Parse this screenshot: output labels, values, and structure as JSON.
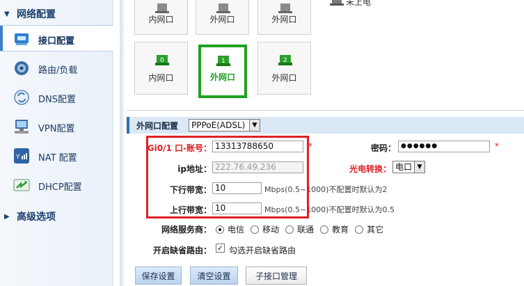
{
  "sidebar": {
    "group_network": "网络配置",
    "items": [
      {
        "label": "接口配置",
        "icon": "network-port-icon"
      },
      {
        "label": "路由/负载",
        "icon": "router-icon"
      },
      {
        "label": "DNS配置",
        "icon": "dns-icon"
      },
      {
        "label": "VPN配置",
        "icon": "vpn-computer-icon"
      },
      {
        "label": "NAT 配置",
        "icon": "nat-icon"
      },
      {
        "label": "DHCP配置",
        "icon": "dhcp-icon"
      }
    ],
    "group_advanced": "高级选项"
  },
  "ports_top": [
    {
      "label": "内网口"
    },
    {
      "label": "外网口"
    },
    {
      "label": "外网口"
    }
  ],
  "legend_unpowered": "未上电",
  "ports_bottom": [
    {
      "num": "0",
      "label": "内网口"
    },
    {
      "num": "1",
      "label": "外网口"
    },
    {
      "num": "2",
      "label": "外网口"
    }
  ],
  "config": {
    "section_title": "外网口配置",
    "mode_value": "PPPoE(ADSL)",
    "account_label": "Gi0/1 口-账号：",
    "account_value": "13313788650",
    "password_label": "密码：",
    "password_value": "●●●●●●",
    "ip_label": "ip地址：",
    "ip_value": "222.76.49.236",
    "optical_label": "光电转换：",
    "optical_value": "电口",
    "down_label": "下行带宽：",
    "down_value": "10",
    "down_hint": "Mbps(0.5~1000)不配置时默认为2",
    "up_label": "上行带宽：",
    "up_value": "10",
    "up_hint": "Mbps(0.5~1000)不配置时默认为0.5",
    "isp_label": "网络服务商：",
    "isp_options": [
      "电信",
      "移动",
      "联通",
      "教育",
      "其它"
    ],
    "isp_selected": "电信",
    "default_route_label": "开启缺省路由：",
    "default_route_text": "勾选开启缺省路由",
    "required_mark": "*"
  },
  "buttons": {
    "save": "保存设置",
    "clear": "清空设置",
    "sub_iface": "子接口管理"
  },
  "colors": {
    "selected_port": "#21a121",
    "highlight_box": "#e21f26",
    "required": "#e02020"
  }
}
